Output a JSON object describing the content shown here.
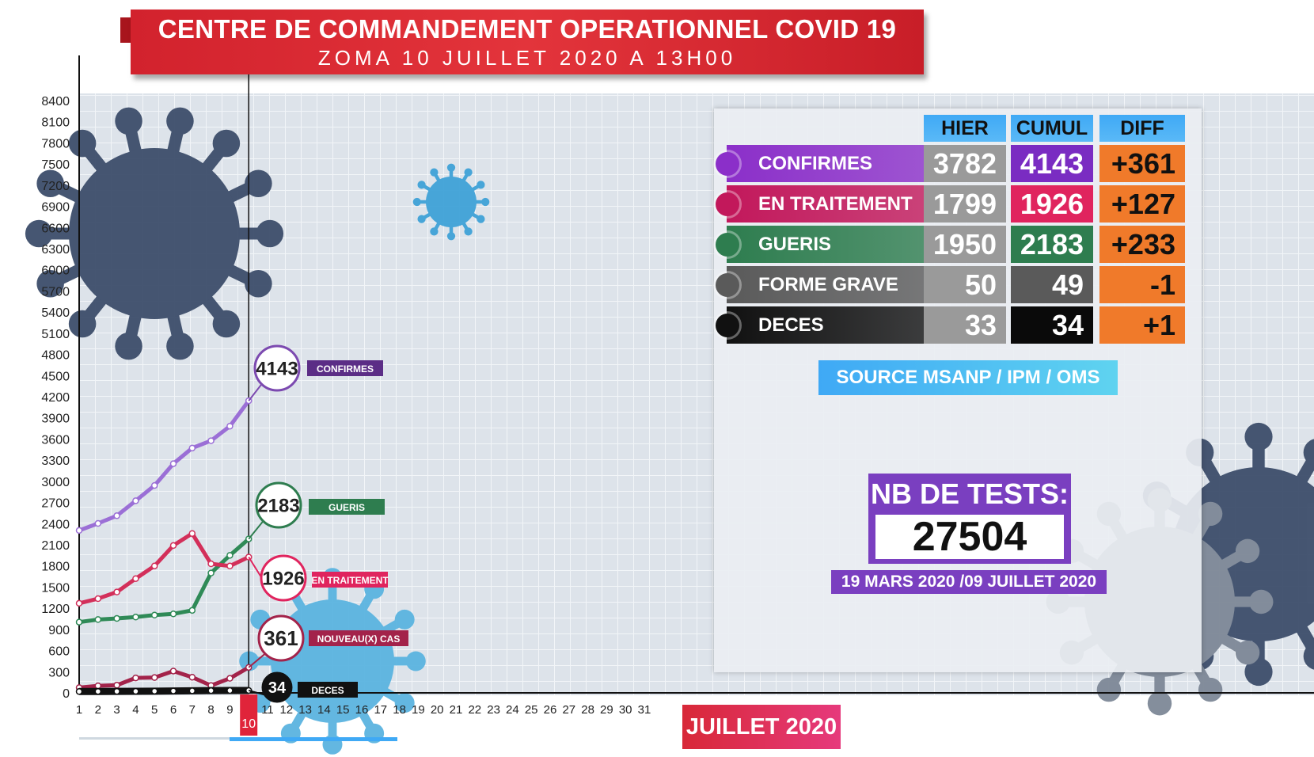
{
  "header": {
    "title": "CENTRE DE COMMANDEMENT OPERATIONNEL COVID 19",
    "subtitle": "ZOMA 10 JUILLET 2020 A 13H00"
  },
  "table": {
    "columns": [
      "HIER",
      "CUMUL",
      "DIFF"
    ],
    "rows": [
      {
        "label": "CONFIRMES",
        "hier": "3782",
        "cumul": "4143",
        "diff": "+361",
        "color": "#8b2fc9",
        "cumul_color": "#7a2cc2"
      },
      {
        "label": "EN TRAITEMENT",
        "hier": "1799",
        "cumul": "1926",
        "diff": "+127",
        "color": "#c2185b",
        "cumul_color": "#e0245e"
      },
      {
        "label": "GUERIS",
        "hier": "1950",
        "cumul": "2183",
        "diff": "+233",
        "color": "#2e7d4f",
        "cumul_color": "#2e7d4f"
      },
      {
        "label": "FORME GRAVE",
        "hier": "50",
        "cumul": "49",
        "diff": "-1",
        "color": "#5a5a5a",
        "cumul_color": "#5a5a5a"
      },
      {
        "label": "DECES",
        "hier": "33",
        "cumul": "34",
        "diff": "+1",
        "color": "#111111",
        "cumul_color": "#0a0a0a"
      }
    ],
    "hier_color": "#9a9a9a",
    "diff_color": "#f07a2a"
  },
  "source": "SOURCE MSANP / IPM / OMS",
  "tests": {
    "title": "NB DE TESTS:",
    "value": "27504",
    "range": "19 MARS 2020 /09 JUILLET 2020"
  },
  "month_label": "JUILLET 2020",
  "current_day": "10",
  "chart_data": {
    "type": "line",
    "x": [
      1,
      2,
      3,
      4,
      5,
      6,
      7,
      8,
      9,
      10
    ],
    "x_ticks": [
      "1",
      "2",
      "3",
      "4",
      "5",
      "6",
      "7",
      "8",
      "9",
      "10",
      "11",
      "12",
      "13",
      "14",
      "15",
      "16",
      "17",
      "18",
      "19",
      "20",
      "21",
      "22",
      "23",
      "24",
      "25",
      "26",
      "27",
      "28",
      "29",
      "30",
      "31"
    ],
    "y_ticks": [
      "0",
      "300",
      "600",
      "900",
      "1200",
      "1500",
      "1800",
      "2100",
      "2400",
      "2700",
      "3000",
      "3300",
      "3600",
      "3900",
      "4200",
      "4500",
      "4800",
      "5100",
      "5400",
      "5700",
      "6000",
      "6300",
      "6600",
      "6900",
      "7200",
      "7500",
      "7800",
      "8100",
      "8400"
    ],
    "ylim": [
      0,
      8400
    ],
    "xlim": [
      1,
      31
    ],
    "series": [
      {
        "name": "CONFIRMES",
        "color": "#9b6fd6",
        "label_color": "#5b2d86",
        "ring_color": "#7c4ab0",
        "callout": "4143",
        "values": [
          2303,
          2403,
          2512,
          2724,
          2941,
          3250,
          3472,
          3576,
          3782,
          4143
        ]
      },
      {
        "name": "GUERIS",
        "color": "#2f8a57",
        "label_color": "#2e7d4f",
        "ring_color": "#2e7d4f",
        "callout": "2183",
        "values": [
          1003,
          1040,
          1055,
          1075,
          1103,
          1120,
          1170,
          1700,
          1950,
          2183
        ]
      },
      {
        "name": "EN TRAITEMENT",
        "color": "#d32f5a",
        "label_color": "#e0245e",
        "ring_color": "#e0245e",
        "callout": "1926",
        "values": [
          1270,
          1336,
          1430,
          1620,
          1800,
          2090,
          2260,
          1830,
          1799,
          1926
        ]
      },
      {
        "name": "NOUVEAU(X) CAS",
        "color": "#a3234a",
        "label_color": "#a3234a",
        "ring_color": "#a3234a",
        "callout": "361",
        "values": [
          75,
          100,
          109,
          212,
          217,
          309,
          222,
          104,
          206,
          361
        ]
      },
      {
        "name": "DECES",
        "color": "#111111",
        "label_color": "#111111",
        "ring_color": "#111111",
        "callout": "34",
        "values": [
          19,
          20,
          21,
          22,
          24,
          27,
          29,
          32,
          33,
          34
        ]
      }
    ]
  }
}
